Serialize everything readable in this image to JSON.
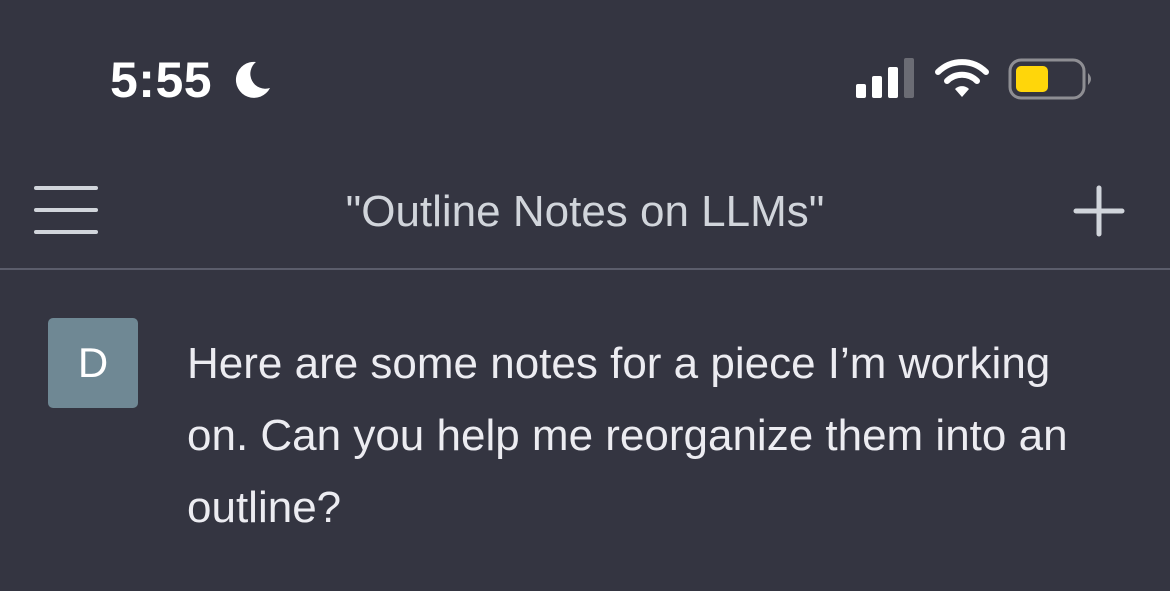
{
  "status_bar": {
    "time": "5:55",
    "focus_icon": "moon-icon",
    "signal_icon": "cellular-signal-icon",
    "wifi_icon": "wifi-icon",
    "battery_icon": "battery-icon",
    "battery_color": "#ffd60a"
  },
  "nav": {
    "menu_icon": "hamburger-menu-icon",
    "title": "\"Outline Notes on LLMs\"",
    "new_icon": "plus-icon"
  },
  "conversation": {
    "messages": [
      {
        "avatar_letter": "D",
        "avatar_color": "#6f8894",
        "text": "Here are some notes for a piece I’m working on. Can you help me reorganize them into an outline?"
      }
    ]
  }
}
